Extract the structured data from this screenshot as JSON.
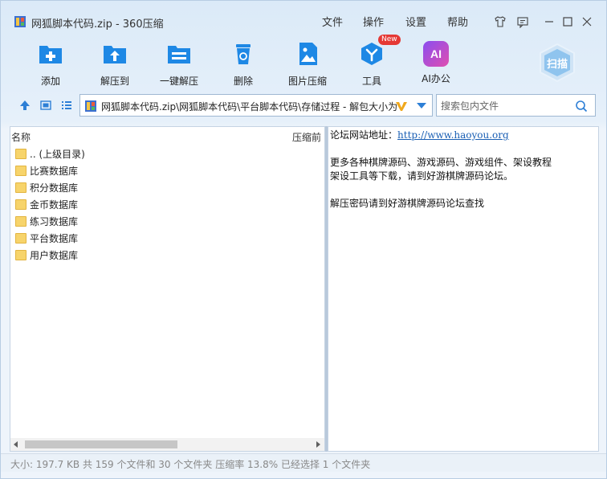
{
  "window": {
    "title": "网狐脚本代码.zip - 360压缩"
  },
  "menu": [
    "文件",
    "操作",
    "设置",
    "帮助"
  ],
  "toolbar": [
    {
      "label": "添加",
      "icon": "add-icon"
    },
    {
      "label": "解压到",
      "icon": "extract-to-icon"
    },
    {
      "label": "一键解压",
      "icon": "one-click-extract-icon"
    },
    {
      "label": "删除",
      "icon": "delete-icon"
    },
    {
      "label": "图片压缩",
      "icon": "image-compress-icon"
    },
    {
      "label": "工具",
      "icon": "tools-icon",
      "badge": "New"
    },
    {
      "label": "AI办公",
      "icon": "ai-office-icon",
      "icon_text": "AI"
    }
  ],
  "scan": {
    "label": "扫描"
  },
  "address": {
    "path": "网狐脚本代码.zip\\网狐脚本代码\\平台脚本代码\\存储过程 - 解包大小为"
  },
  "search": {
    "placeholder": "搜索包内文件"
  },
  "file_list": {
    "columns": {
      "name": "名称",
      "compressed": "压缩前"
    },
    "rows": [
      "..  (上级目录)",
      "比赛数据库",
      "积分数据库",
      "金币数据库",
      "练习数据库",
      "平台数据库",
      "用户数据库"
    ]
  },
  "info_panel": {
    "line1_prefix": "论坛网站地址：",
    "line1_link": "http://www.haoyou.org",
    "line2": "更多各种棋牌源码、游戏源码、游戏组件、架设教程",
    "line3": "架设工具等下载，请到好游棋牌源码论坛。",
    "line4": "解压密码请到好游棋牌源码论坛查找"
  },
  "status": "大小: 197.7 KB 共 159 个文件和 30 个文件夹 压缩率 13.8% 已经选择 1 个文件夹",
  "colors": {
    "accent": "#1e88e5",
    "ai_gradient": [
      "#8a4df0",
      "#e04fb0"
    ],
    "badge": "#e53935",
    "folder": "#f7d46b"
  }
}
